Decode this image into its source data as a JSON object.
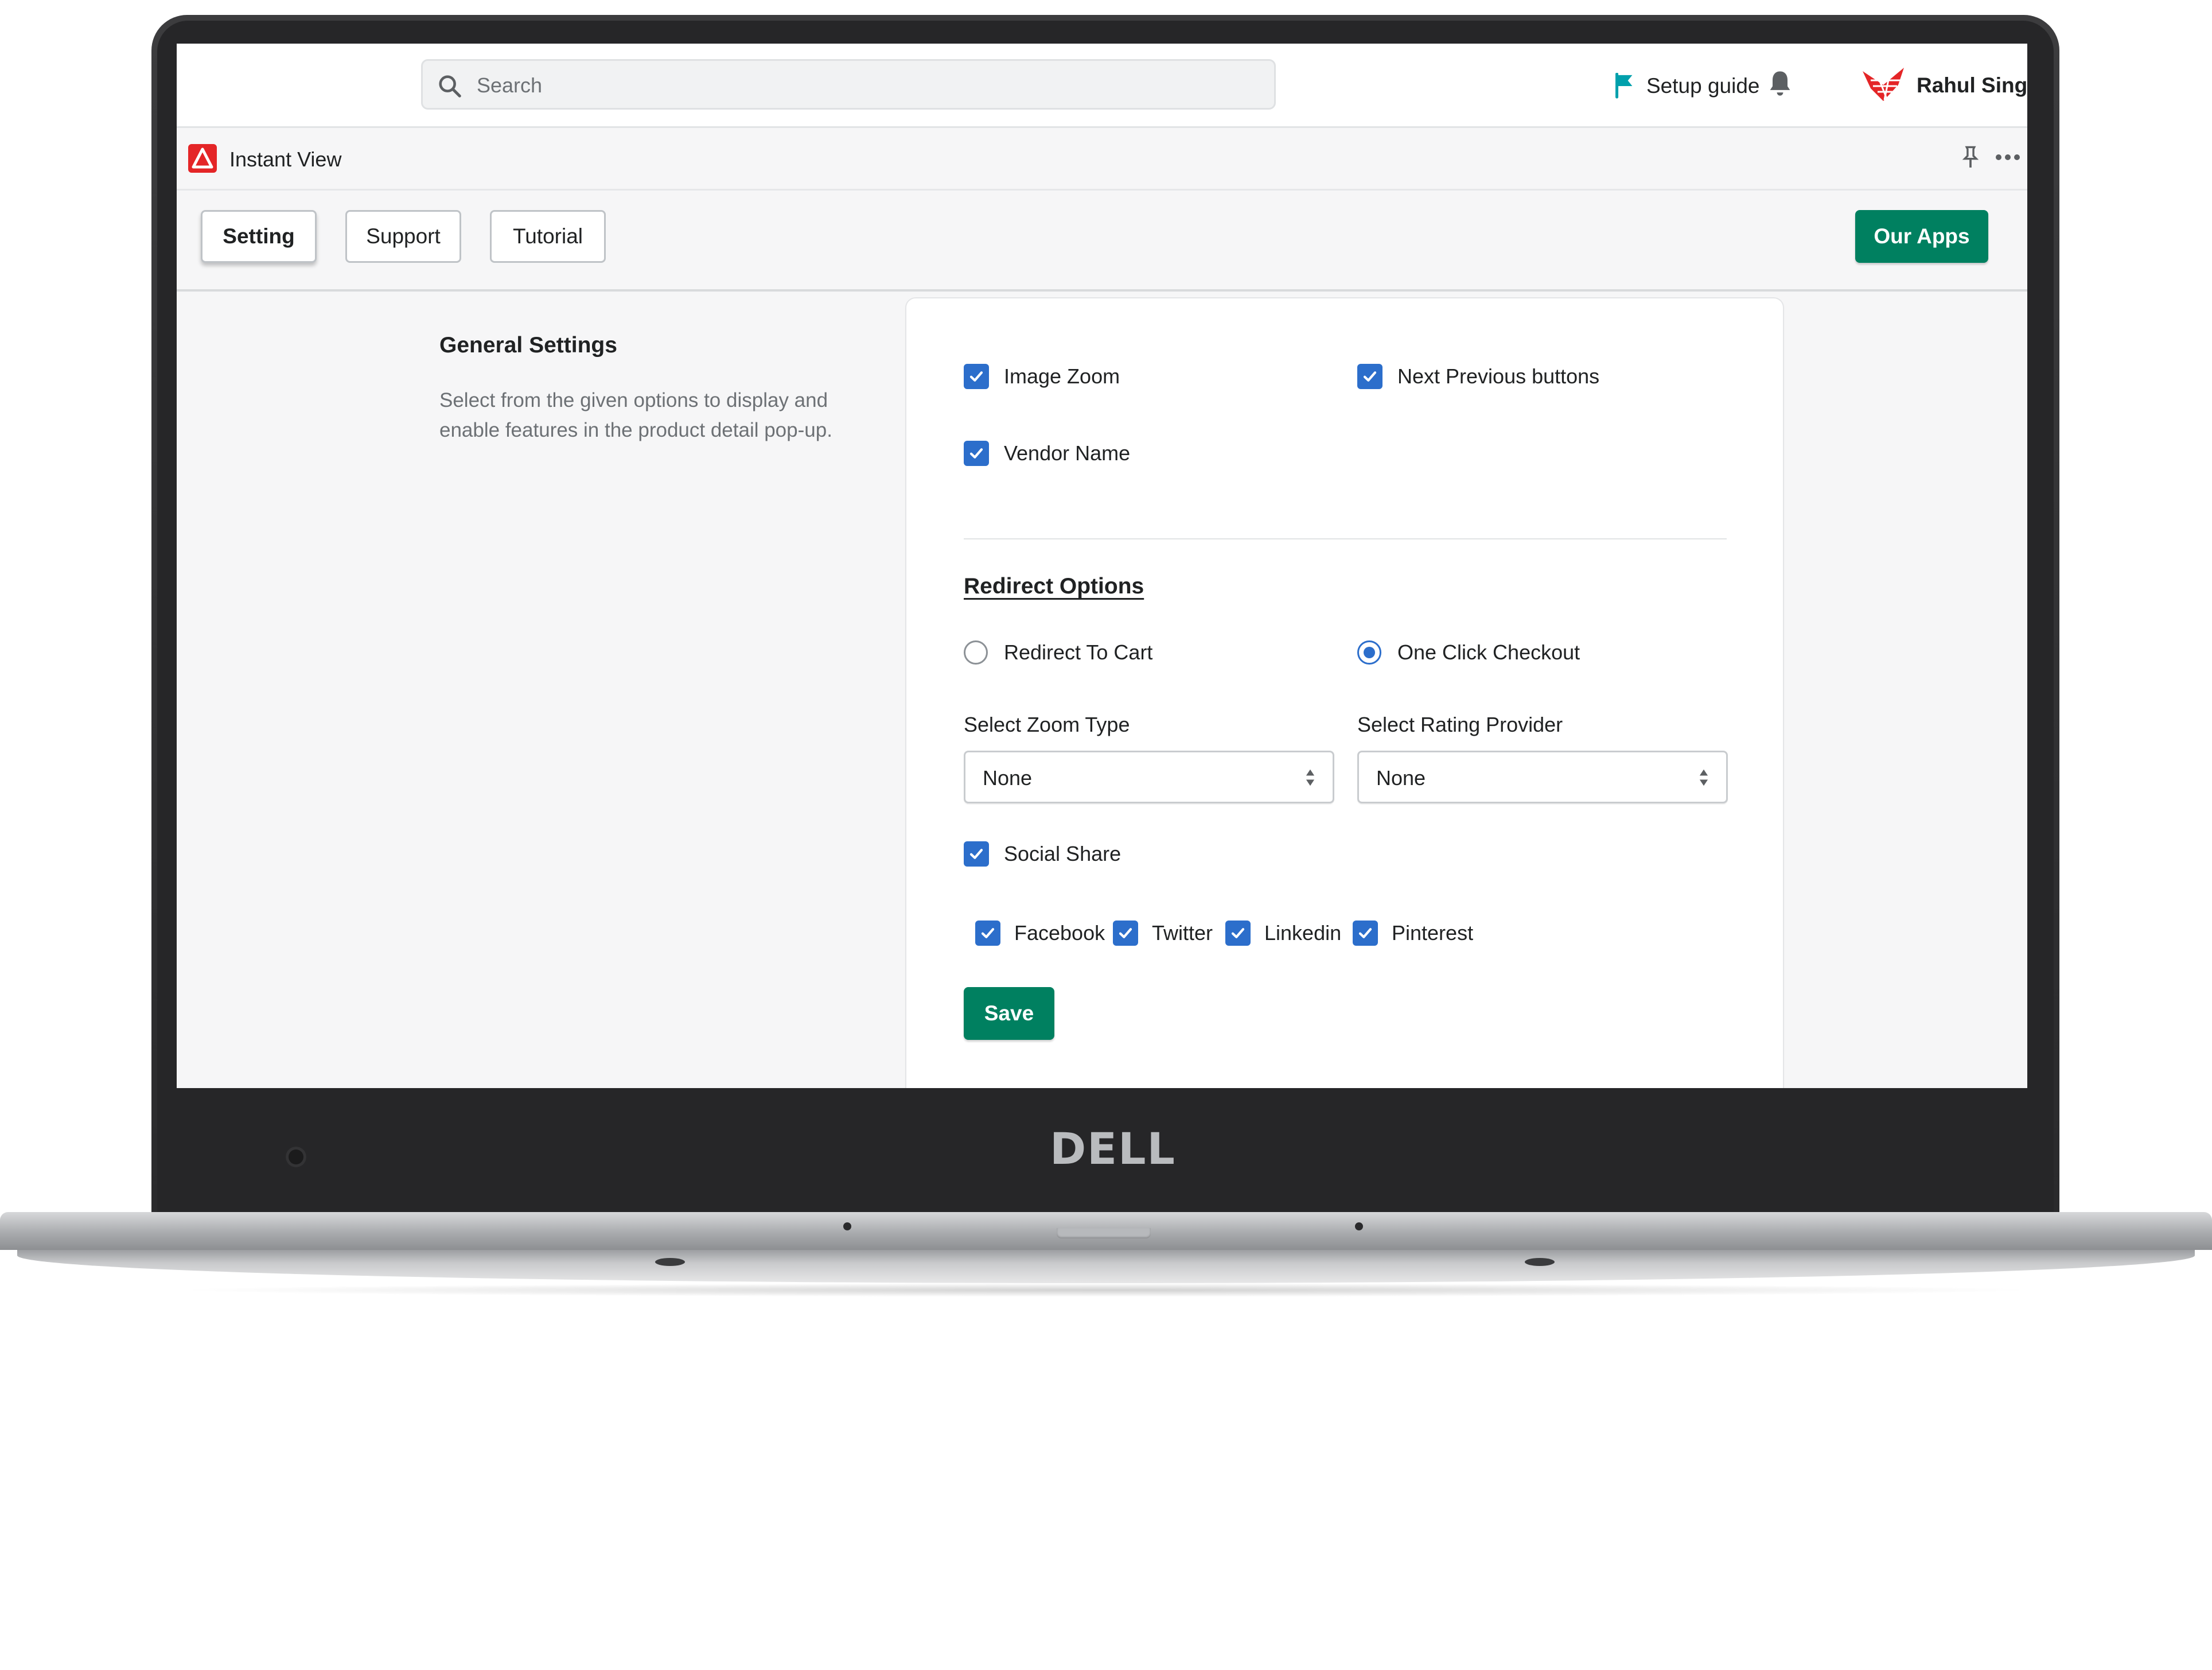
{
  "device": {
    "brand": "DELL"
  },
  "topbar": {
    "search_placeholder": "Search",
    "setup_guide": "Setup guide",
    "user_name": "Rahul Singh"
  },
  "appbar": {
    "title": "Instant View"
  },
  "nav": {
    "tabs": [
      {
        "label": "Setting",
        "active": true
      },
      {
        "label": "Support",
        "active": false
      },
      {
        "label": "Tutorial",
        "active": false
      }
    ],
    "our_apps": "Our Apps"
  },
  "general": {
    "title": "General Settings",
    "description": "Select from the given options to display and enable features in the product detail pop-up."
  },
  "options": {
    "image_zoom": "Image Zoom",
    "next_previous": "Next Previous buttons",
    "vendor_name": "Vendor Name"
  },
  "redirect": {
    "title": "Redirect Options",
    "to_cart": "Redirect To Cart",
    "one_click": "One Click Checkout",
    "selected": "One Click Checkout"
  },
  "zoom_type": {
    "label": "Select Zoom Type",
    "value": "None"
  },
  "rating_provider": {
    "label": "Select Rating Provider",
    "value": "None"
  },
  "social": {
    "label": "Social Share",
    "networks": [
      "Facebook",
      "Twitter",
      "Linkedin",
      "Pinterest"
    ]
  },
  "save_label": "Save",
  "colors": {
    "primary_green": "#008060",
    "checkbox_blue": "#2c6ecb",
    "setup_flag": "#00a0ac",
    "logo_red": "#e42527"
  }
}
